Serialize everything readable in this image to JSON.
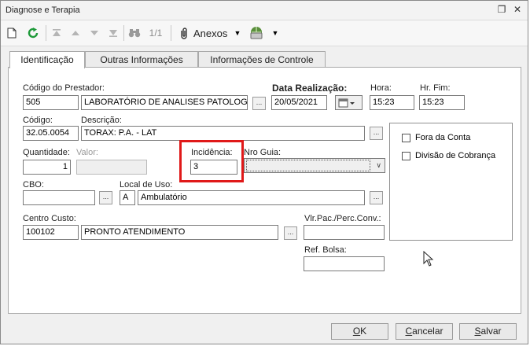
{
  "window": {
    "title": "Diagnose e Terapia"
  },
  "toolbar": {
    "record_counter": "1/1",
    "anexos_label": "Anexos"
  },
  "tabs": [
    {
      "label": "Identificação"
    },
    {
      "label": "Outras Informações"
    },
    {
      "label": "Informações de Controle"
    }
  ],
  "form": {
    "codigo_prestador_label": "Código do Prestador:",
    "codigo_prestador_value": "505",
    "prestador_nome_value": "LABORATÓRIO DE ANALISES PATOLOGI",
    "data_realizacao_label": "Data Realização:",
    "data_realizacao_value": "20/05/2021",
    "hora_label": "Hora:",
    "hora_value": "15:23",
    "hr_fim_label": "Hr. Fim:",
    "hr_fim_value": "15:23",
    "codigo_label": "Código:",
    "codigo_value": "32.05.0054",
    "descricao_label": "Descrição:",
    "descricao_value": "TORAX: P.A. - LAT",
    "quantidade_label": "Quantidade:",
    "quantidade_value": "1",
    "valor_label": "Valor:",
    "valor_value": "",
    "incidencia_label": "Incidência:",
    "incidencia_value": "3",
    "nro_guia_label": "Nro Guia:",
    "nro_guia_value": "",
    "cbo_label": "CBO:",
    "cbo_value": "",
    "local_uso_label": "Local de Uso:",
    "local_uso_code": "A",
    "local_uso_value": "Ambulatório",
    "centro_custo_label": "Centro Custo:",
    "centro_custo_code": "100102",
    "centro_custo_value": "PRONTO ATENDIMENTO",
    "vlr_pac_label": "Vlr.Pac./Perc.Conv.:",
    "vlr_pac_value": "",
    "ref_bolsa_label": "Ref. Bolsa:",
    "ref_bolsa_value": "",
    "dots_label": "...",
    "fora_conta_label": "Fora da Conta",
    "fora_conta_checked": false,
    "divisao_cobranca_label": "Divisão de Cobrança",
    "divisao_cobranca_checked": false
  },
  "buttons": {
    "ok_u": "O",
    "ok_rest": "K",
    "cancelar_u": "C",
    "cancelar_rest": "ancelar",
    "salvar_u": "S",
    "salvar_rest": "alvar"
  },
  "colors": {
    "highlight": "#e01919",
    "refresh_green": "#1f9a3a"
  }
}
